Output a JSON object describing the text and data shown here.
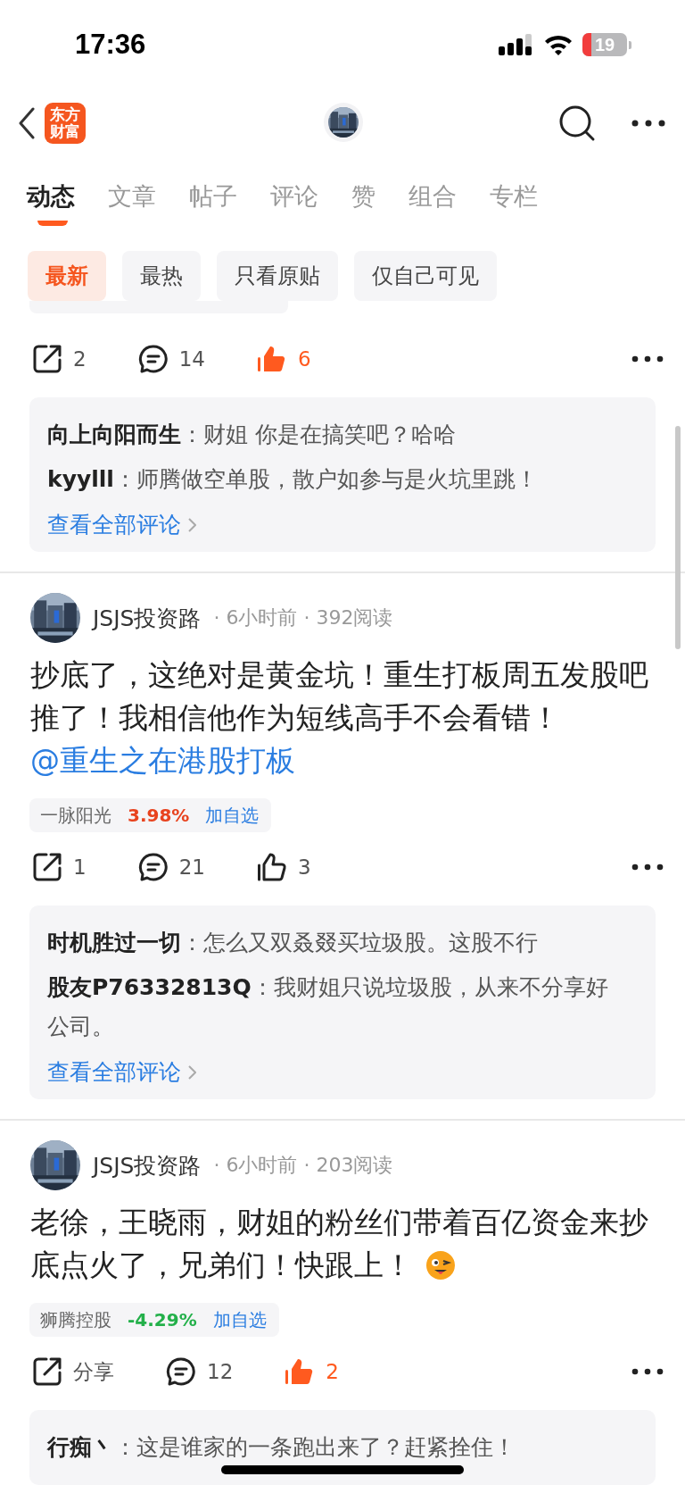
{
  "status_bar": {
    "time": "17:36",
    "battery": "19"
  },
  "nav": {
    "logo": "东方财富"
  },
  "tabs": [
    {
      "label": "动态",
      "selected": true
    },
    {
      "label": "文章",
      "selected": false
    },
    {
      "label": "帖子",
      "selected": false
    },
    {
      "label": "评论",
      "selected": false
    },
    {
      "label": "赞",
      "selected": false
    },
    {
      "label": "组合",
      "selected": false
    },
    {
      "label": "专栏",
      "selected": false
    }
  ],
  "filters": [
    {
      "label": "最新",
      "selected": true
    },
    {
      "label": "最热",
      "selected": false
    },
    {
      "label": "只看原贴",
      "selected": false
    },
    {
      "label": "仅自己可见",
      "selected": false
    }
  ],
  "posts": [
    {
      "stock": {
        "kind": "cut"
      },
      "share": "2",
      "comments_count": "14",
      "like": {
        "count": "6",
        "liked": true
      },
      "comments": [
        "**向上向阳而生**：财姐 你是在搞笑吧？哈哈",
        "**kyylll**：师腾做空单股，散户如参与是火坑里跳！"
      ],
      "more": "查看全部评论"
    },
    {
      "author": "JSJS投资路",
      "meta": "· 6小时前 · 392阅读",
      "body": "抄底了，这绝对是黄金坑！重生打板周五发股吧推了！我相信他作为短线高手不会看错！",
      "mention": "@重生之在港股打板",
      "stock": {
        "kind": "full",
        "name": "一脉阳光",
        "change": "3.98%",
        "color": "#e8431e",
        "add": "加自选"
      },
      "share": "1",
      "comments_count": "21",
      "like": {
        "count": "3",
        "liked": false
      },
      "comments": [
        "**时机胜过一切**：怎么又双叒叕买垃圾股。这股不行",
        "**股友P76332813Q**：我财姐只说垃圾股，从来不分享好公司。"
      ],
      "more": "查看全部评论"
    },
    {
      "author": "JSJS投资路",
      "meta": "· 6小时前 · 203阅读",
      "body": "老徐，王晓雨，财姐的粉丝们带着百亿资金来抄底点火了，兄弟们！快跟上！",
      "emoji": true,
      "stock": {
        "kind": "full",
        "name": "狮腾控股",
        "change": "-4.29%",
        "color": "#23b04a",
        "add": "加自选"
      },
      "share": "分享",
      "comments_count": "12",
      "like": {
        "count": "2",
        "liked": true
      },
      "comments": [
        "**行痴丶**：这是谁家的一条跑出来了？赶紧拴住！"
      ]
    }
  ]
}
